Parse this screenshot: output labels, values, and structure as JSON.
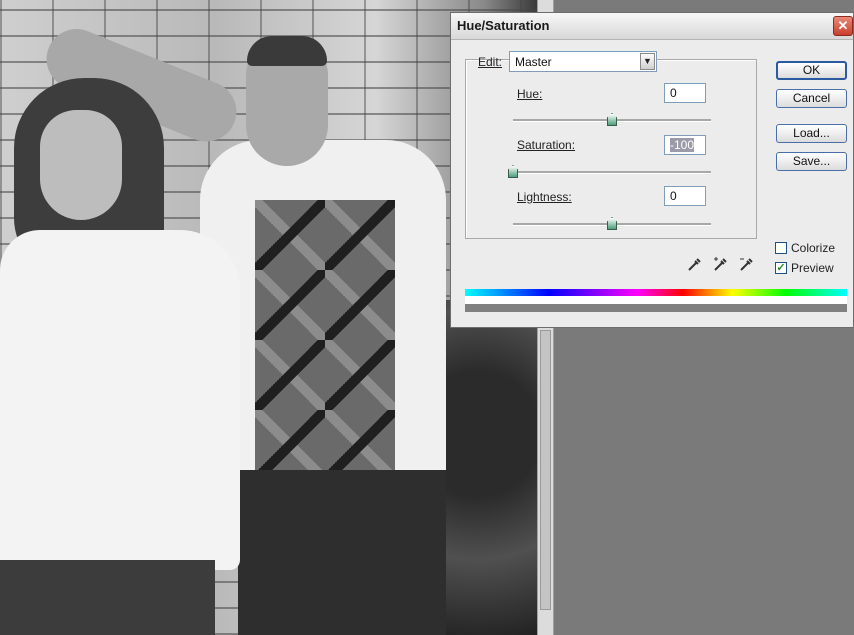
{
  "dialog": {
    "title": "Hue/Saturation",
    "close_label": "✕",
    "edit": {
      "label": "Edit:",
      "value": "Master"
    },
    "hue": {
      "label": "Hue:",
      "value": "0",
      "level": 0.5
    },
    "saturation": {
      "label": "Saturation:",
      "value": "-100",
      "level": 0.0
    },
    "lightness": {
      "label": "Lightness:",
      "value": "0",
      "level": 0.5
    },
    "buttons": {
      "ok": "OK",
      "cancel": "Cancel",
      "load": "Load...",
      "save": "Save..."
    },
    "colorize": {
      "label": "Colorize",
      "checked": false
    },
    "preview": {
      "label": "Preview",
      "checked": true
    },
    "icons": [
      "eyedropper-icon",
      "eyedropper-plus-icon",
      "eyedropper-minus-icon"
    ]
  },
  "colors": {
    "dialog_bg": "#ececec",
    "workspace_bg": "#7a7a7a",
    "slider_thumb": "#4aa07a"
  }
}
